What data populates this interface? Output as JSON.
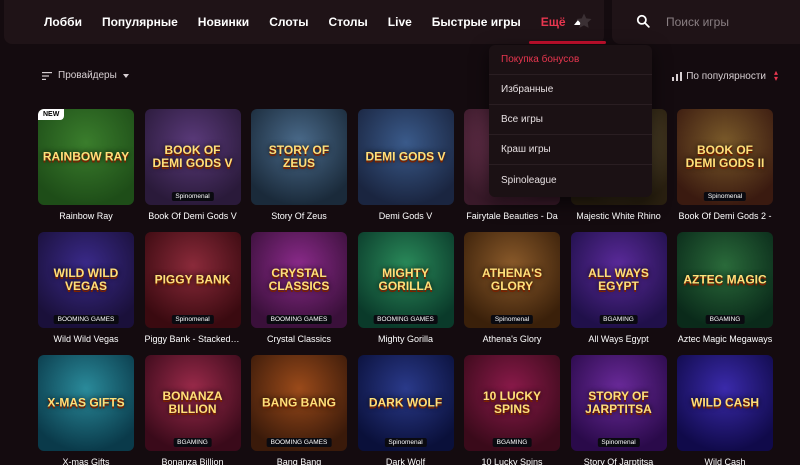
{
  "nav": {
    "items": [
      {
        "label": "Лобби"
      },
      {
        "label": "Популярные"
      },
      {
        "label": "Новинки"
      },
      {
        "label": "Слоты"
      },
      {
        "label": "Столы"
      },
      {
        "label": "Live"
      },
      {
        "label": "Быстрые игры"
      },
      {
        "label": "Ещё"
      }
    ],
    "active_index": 7
  },
  "search": {
    "placeholder": "Поиск игры"
  },
  "filters": {
    "providers_label": "Провайдеры",
    "sort_label": "По популярности"
  },
  "dropdown": {
    "items": [
      {
        "label": "Покупка бонусов",
        "active": true
      },
      {
        "label": "Избранные"
      },
      {
        "label": "Все игры"
      },
      {
        "label": "Краш игры"
      },
      {
        "label": "Spinoleague"
      }
    ]
  },
  "colors": {
    "accent": "#e8364f",
    "background": "#140b0f",
    "panel": "#1f1317"
  },
  "games": [
    {
      "name": "Rainbow Ray",
      "art": "RAINBOW RAY",
      "badge": "NEW",
      "bg": "#3a7d2c",
      "bg2": "#1e4d18"
    },
    {
      "name": "Book Of Demi Gods V",
      "art": "BOOK OF DEMI GODS V",
      "provider": "Spinomenal",
      "bg": "#5a3a7a",
      "bg2": "#2a1a3a"
    },
    {
      "name": "Story Of Zeus",
      "art": "STORY OF ZEUS",
      "bg": "#4a6a8a",
      "bg2": "#1a2a3a"
    },
    {
      "name": "Demi Gods V",
      "art": "DEMI GODS V",
      "bg": "#3a5a8a",
      "bg2": "#1a2540"
    },
    {
      "name": "Fairytale Beauties - Da",
      "art": "",
      "bg": "#7a3a5a",
      "bg2": "#3a1a2a"
    },
    {
      "name": "Majestic White Rhino",
      "art": "",
      "bg": "#6a5a3a",
      "bg2": "#2a2010"
    },
    {
      "name": "Book Of Demi Gods 2 -",
      "art": "BOOK OF DEMI GODS II",
      "provider": "Spinomenal",
      "bg": "#7a5a2a",
      "bg2": "#3a1a10"
    },
    {
      "name": "Wild Wild Vegas",
      "art": "WILD WILD VEGAS",
      "provider": "BOOMING GAMES",
      "bg": "#3a2a8a",
      "bg2": "#1a103a"
    },
    {
      "name": "Piggy Bank - Stacked F...",
      "art": "PIGGY BANK",
      "provider": "Spinomenal",
      "bg": "#8a2a3a",
      "bg2": "#3a0a10"
    },
    {
      "name": "Crystal Classics",
      "art": "CRYSTAL CLASSICS",
      "provider": "BOOMING GAMES",
      "bg": "#8a2a8a",
      "bg2": "#3a103a"
    },
    {
      "name": "Mighty Gorilla",
      "art": "MIGHTY GORILLA",
      "provider": "BOOMING GAMES",
      "bg": "#2a8a5a",
      "bg2": "#0a3a2a"
    },
    {
      "name": "Athena's Glory",
      "art": "ATHENA'S GLORY",
      "provider": "Spinomenal",
      "bg": "#8a5a2a",
      "bg2": "#3a200a"
    },
    {
      "name": "All Ways Egypt",
      "art": "ALL WAYS EGYPT",
      "provider": "BGAMING",
      "bg": "#5a2a9a",
      "bg2": "#20104a"
    },
    {
      "name": "Aztec Magic Megaways",
      "art": "AZTEC MAGIC",
      "provider": "BGAMING",
      "bg": "#2a6a3a",
      "bg2": "#0a2a1a"
    },
    {
      "name": "X-mas Gifts",
      "art": "X-MAS GIFTS",
      "bg": "#2a8a9a",
      "bg2": "#0a3a4a"
    },
    {
      "name": "Bonanza Billion",
      "art": "BONANZA BILLION",
      "provider": "BGAMING",
      "bg": "#9a2a4a",
      "bg2": "#3a0a1a"
    },
    {
      "name": "Bang Bang",
      "art": "BANG BANG",
      "provider": "BOOMING GAMES",
      "bg": "#9a4a1a",
      "bg2": "#3a1a0a"
    },
    {
      "name": "Dark Wolf",
      "art": "DARK WOLF",
      "provider": "Spinomenal",
      "bg": "#2a3a8a",
      "bg2": "#0a103a"
    },
    {
      "name": "10 Lucky Spins",
      "art": "10 LUCKY SPINS",
      "provider": "BGAMING",
      "bg": "#8a1a4a",
      "bg2": "#3a0a1a"
    },
    {
      "name": "Story Of Jarptitsa",
      "art": "STORY OF JARPTITSA",
      "provider": "Spinomenal",
      "bg": "#6a2a9a",
      "bg2": "#2a0a4a"
    },
    {
      "name": "Wild Cash",
      "art": "WILD CASH",
      "bg": "#3a2aaa",
      "bg2": "#100a4a"
    }
  ]
}
